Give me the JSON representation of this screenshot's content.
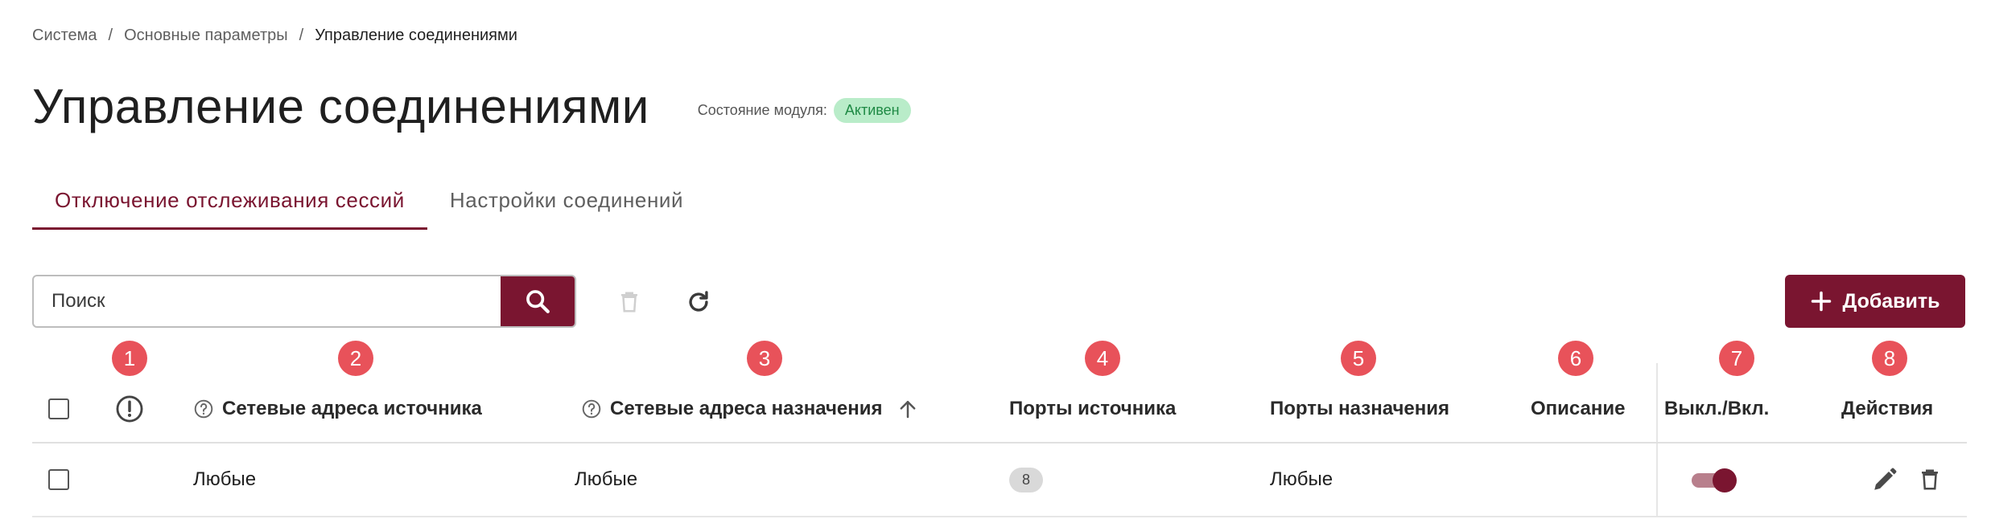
{
  "breadcrumb": {
    "items": [
      "Система",
      "Основные параметры",
      "Управление соединениями"
    ],
    "separator": "/"
  },
  "header": {
    "title": "Управление соединениями",
    "module_status_label": "Состояние модуля:",
    "module_status_value": "Активен"
  },
  "tabs": [
    {
      "label": "Отключение отслеживания сессий",
      "active": true
    },
    {
      "label": "Настройки соединений",
      "active": false
    }
  ],
  "toolbar": {
    "search_placeholder": "Поиск",
    "search_icon": "search-icon",
    "delete_icon": "trash-icon",
    "refresh_icon": "refresh-icon",
    "add_label": "Добавить",
    "add_icon": "plus-icon"
  },
  "markers": [
    "1",
    "2",
    "3",
    "4",
    "5",
    "6",
    "7",
    "8"
  ],
  "table": {
    "columns": {
      "source_addresses": "Сетевые адреса источника",
      "dest_addresses": "Сетевые адреса назначения",
      "source_ports": "Порты источника",
      "dest_ports": "Порты назначения",
      "description": "Описание",
      "toggle": "Выкл./Вкл.",
      "actions": "Действия"
    },
    "rows": [
      {
        "source_addresses": "Любые",
        "dest_addresses": "Любые",
        "source_ports": "8",
        "dest_ports": "Любые",
        "description": "",
        "enabled": true
      }
    ]
  },
  "colors": {
    "accent": "#7a1530",
    "marker": "#e8525a",
    "status_bg": "#b9ecc9",
    "status_text": "#1f8a45"
  }
}
